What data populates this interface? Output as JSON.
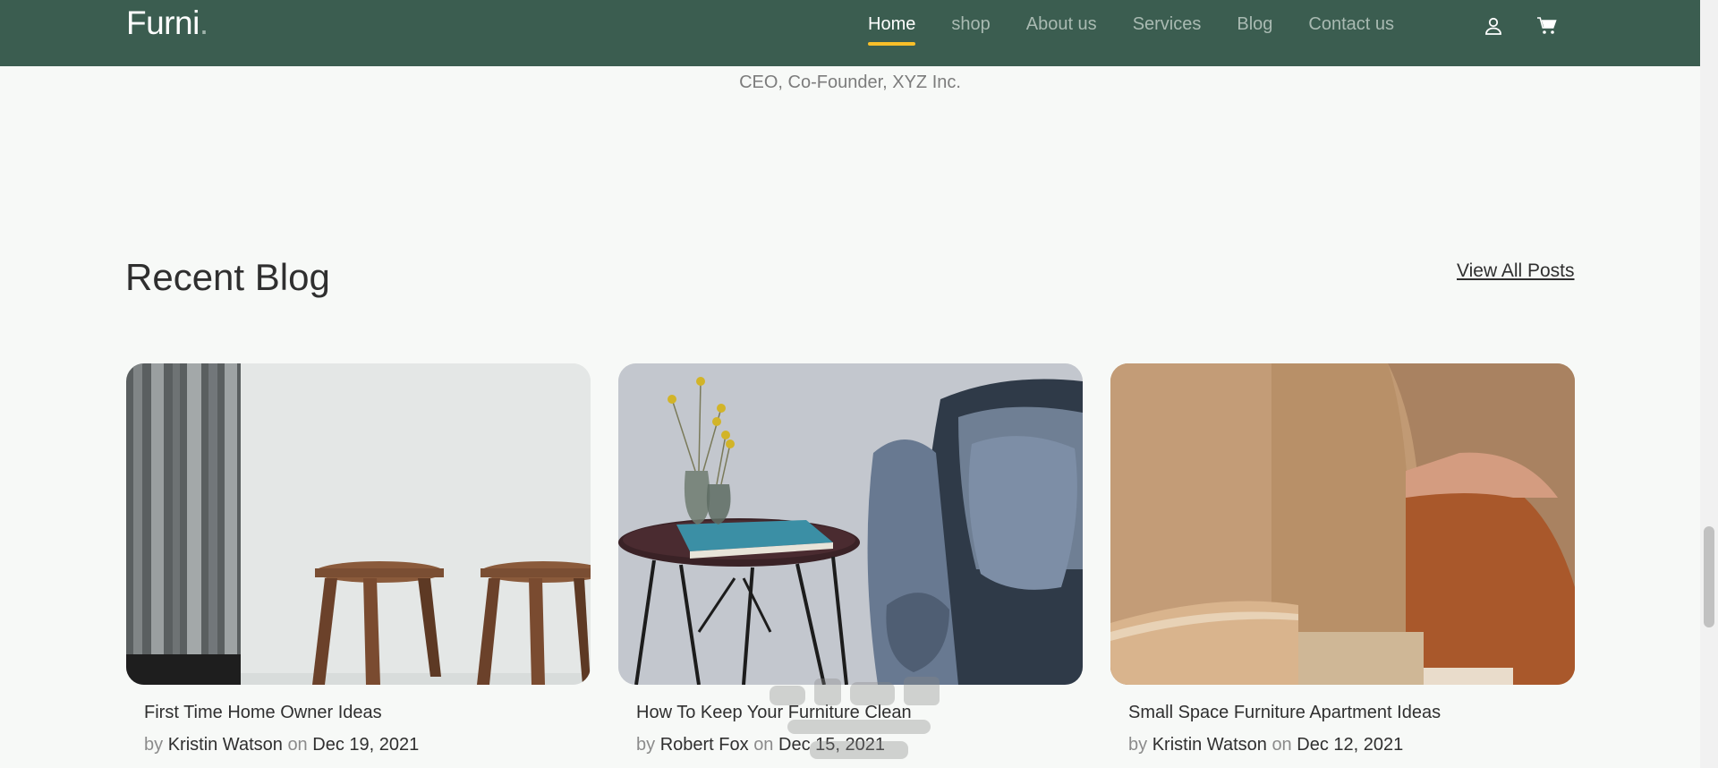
{
  "brand": {
    "name": "Furni",
    "dot": "."
  },
  "nav": {
    "links": [
      {
        "label": "Home",
        "active": true
      },
      {
        "label": "shop"
      },
      {
        "label": "About us"
      },
      {
        "label": "Services"
      },
      {
        "label": "Blog"
      },
      {
        "label": "Contact us"
      }
    ],
    "icons": [
      "user-icon",
      "cart-icon"
    ]
  },
  "testimonial": {
    "role": "CEO, Co-Founder, XYZ Inc."
  },
  "blog": {
    "title": "Recent Blog",
    "view_all": "View All Posts",
    "by_word": "by",
    "on_word": "on",
    "posts": [
      {
        "title": "First Time Home Owner Ideas",
        "author": "Kristin Watson",
        "date": "Dec 19, 2021"
      },
      {
        "title": "How To Keep Your Furniture Clean",
        "author": "Robert Fox",
        "date": "Dec 15, 2021"
      },
      {
        "title": "Small Space Furniture Apartment Ideas",
        "author": "Kristin Watson",
        "date": "Dec 12, 2021"
      }
    ]
  },
  "colors": {
    "header_bg": "#3b5d50",
    "page_bg": "#f7f9f7",
    "accent": "#f9bf29"
  }
}
